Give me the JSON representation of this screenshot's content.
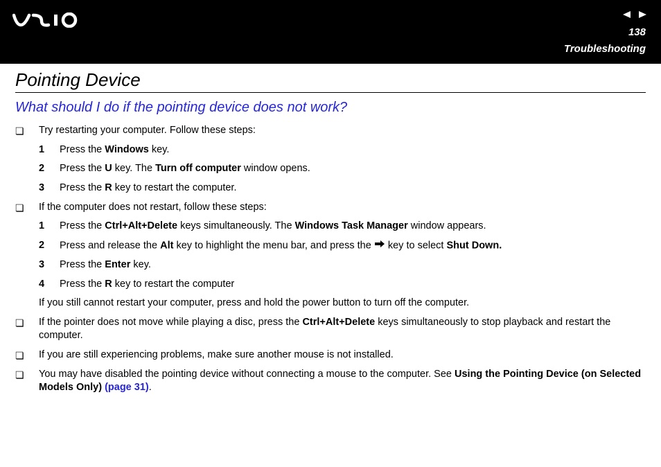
{
  "header": {
    "page_number": "138",
    "section": "Troubleshooting"
  },
  "heading": "Pointing Device",
  "subheading": "What should I do if the pointing device does not work?",
  "bullets": {
    "b1": "Try restarting your computer. Follow these steps:",
    "b2": "If the computer does not restart, follow these steps:",
    "b3_pre": "If the pointer does not move while playing a disc, press the ",
    "b3_bold": "Ctrl+Alt+Delete",
    "b3_post": " keys simultaneously to stop playback and restart the computer.",
    "b4": "If you are still experiencing problems, make sure another mouse is not installed.",
    "b5_pre": "You may have disabled the pointing device without connecting a mouse to the computer. See ",
    "b5_bold": "Using the Pointing Device (on Selected Models Only) ",
    "b5_link": "(page 31)",
    "b5_post": "."
  },
  "list1": {
    "i1_pre": "Press the ",
    "i1_b": "Windows",
    "i1_post": " key.",
    "i2_pre": "Press the ",
    "i2_b1": "U",
    "i2_mid": " key. The ",
    "i2_b2": "Turn off computer",
    "i2_post": " window opens.",
    "i3_pre": "Press the ",
    "i3_b": "R",
    "i3_post": " key to restart the computer."
  },
  "list2": {
    "i1_pre": "Press the ",
    "i1_b1": "Ctrl+Alt+Delete",
    "i1_mid": " keys simultaneously. The ",
    "i1_b2": "Windows Task Manager",
    "i1_post": " window appears.",
    "i2_pre": "Press and release the ",
    "i2_b1": "Alt",
    "i2_mid": " key to highlight the menu bar, and press the ",
    "i2_post": " key to select ",
    "i2_b2": "Shut Down.",
    "i3_pre": "Press the ",
    "i3_b": "Enter",
    "i3_post": " key.",
    "i4_pre": "Press the ",
    "i4_b": "R",
    "i4_post": " key to restart the computer"
  },
  "note": "If you still cannot restart your computer, press and hold the power button to turn off the computer.",
  "nums": {
    "n1": "1",
    "n2": "2",
    "n3": "3",
    "n4": "4"
  },
  "bullet_char": "❏"
}
